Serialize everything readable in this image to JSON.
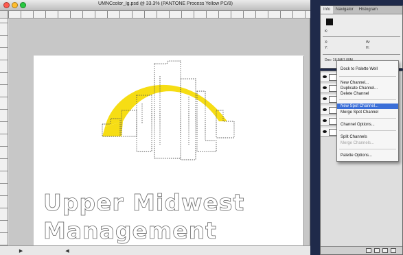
{
  "window": {
    "title": "UMNCcolor_lg.psd @ 33.3% (PANTONE Process Yellow PC/8)"
  },
  "artwork": {
    "company_name_line1": "Upper Midwest",
    "company_name_line2": "Management",
    "highlight_color": "#f6dd14"
  },
  "info_panel": {
    "tabs": [
      "Info",
      "Navigator",
      "Histogram"
    ],
    "values": [
      "K:",
      "X:",
      "Y:",
      "W:",
      "H:",
      "Doc: 18.9M/1.00M"
    ]
  },
  "channels_menu": {
    "items": [
      {
        "label": "Dock to Palette Well",
        "state": "normal"
      },
      {
        "label": "New Channel...",
        "state": "normal"
      },
      {
        "label": "Duplicate Channel...",
        "state": "normal"
      },
      {
        "label": "Delete Channel",
        "state": "normal"
      },
      {
        "label": "New Spot Channel...",
        "state": "selected"
      },
      {
        "label": "Merge Spot Channel",
        "state": "normal"
      },
      {
        "label": "Channel Options...",
        "state": "normal"
      },
      {
        "label": "Split Channels",
        "state": "normal"
      },
      {
        "label": "Merge Channels...",
        "state": "disabled"
      },
      {
        "label": "Palette Options...",
        "state": "normal"
      }
    ]
  },
  "icons": {
    "eye": "eye-icon",
    "new_channel": "new-channel-icon",
    "delete_channel": "trash-icon"
  }
}
